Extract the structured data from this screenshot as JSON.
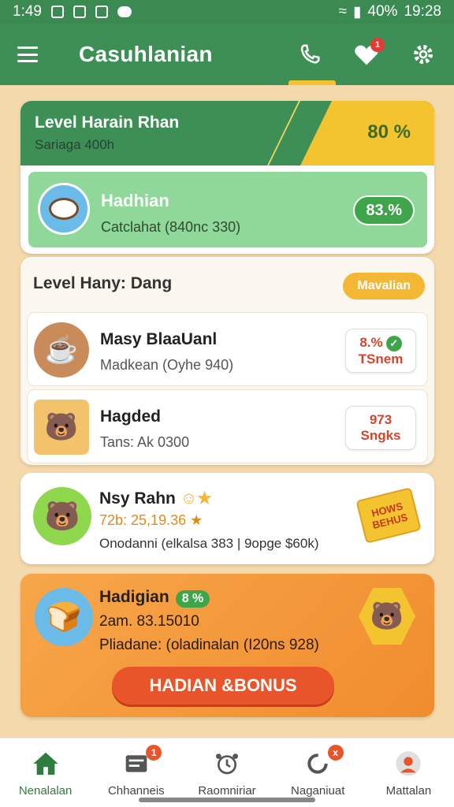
{
  "status_bar": {
    "time_left": "1:49",
    "battery": "40%",
    "time_right": "19:28"
  },
  "app_bar": {
    "title": "Casuhlanian",
    "notification_count": "1"
  },
  "level_card": {
    "title": "Level Harain Rhan",
    "subtitle": "Sariaga 400h",
    "percent": "80 %",
    "highlight": {
      "title": "Hadhian",
      "subtitle": "Catclahat (840nc 330)",
      "percent": "83.%"
    }
  },
  "daily_section": {
    "title": "Level Hany: Dang",
    "button_label": "Mavalian",
    "items": [
      {
        "title": "Masy BlaaUanl",
        "subtitle": "Madkean (Oyhe 940)",
        "badge_top": "8.%",
        "badge_bottom": "TSnem",
        "icon": "coffee-icon"
      },
      {
        "title": "Hagded",
        "subtitle": "Tans: Ak 0300",
        "badge_top": "973",
        "badge_bottom": "Sngks",
        "icon": "beaver-icon"
      }
    ]
  },
  "featured_item": {
    "title": "Nsy Rahn",
    "meta": "72b: 25,19.36",
    "subtitle": "Onodanni (elkalsa 383 | 9opge $60k)",
    "bonus_tag": "HOWS BEHUS",
    "icon": "beaver-icon"
  },
  "promo_card": {
    "title": "Hadigian",
    "title_badge": "8 %",
    "meta": "2am. 83.15010",
    "subtitle": "Pliadane: (oladinalan (I20ns 928)",
    "cta_label": "HADIAN &BONUS",
    "icon": "toast-icon"
  },
  "bottom_nav": [
    {
      "label": "Nenalalan",
      "icon": "home-icon",
      "active": true
    },
    {
      "label": "Chhanneis",
      "icon": "channels-icon",
      "badge": "1"
    },
    {
      "label": "Raomniriar",
      "icon": "alarm-icon"
    },
    {
      "label": "Naganiuat",
      "icon": "refresh-icon",
      "badge": "x"
    },
    {
      "label": "Mattalan",
      "icon": "profile-icon"
    }
  ],
  "colors": {
    "primary_green": "#3e8f56",
    "accent_yellow": "#f4c430",
    "accent_orange": "#f08c2e",
    "cta_red": "#e9552b"
  }
}
